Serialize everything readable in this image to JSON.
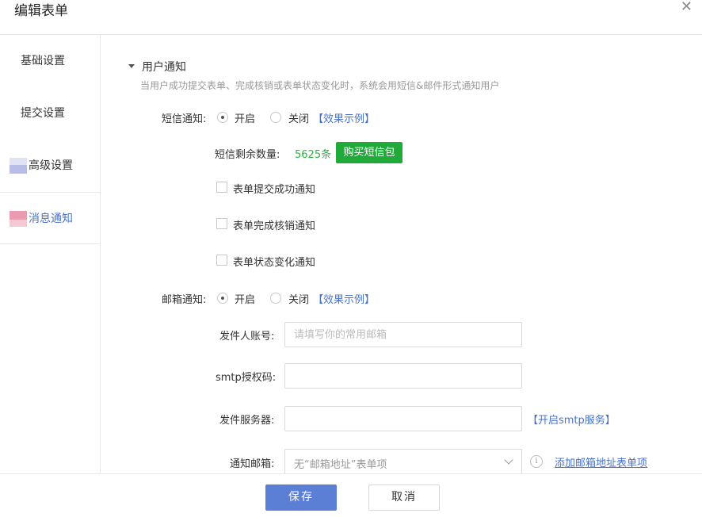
{
  "dialog": {
    "title": "编辑表单",
    "close_glyph": "✕"
  },
  "sidebar": {
    "items": [
      {
        "label": "基础设置"
      },
      {
        "label": "提交设置"
      },
      {
        "label": "高级设置"
      },
      {
        "label": "消息通知"
      }
    ]
  },
  "section": {
    "title": "用户通知",
    "description": "当用户成功提交表单、完成核销或表单状态变化时，系统会用短信&邮件形式通知用户"
  },
  "sms": {
    "label": "短信通知:",
    "option_on": "开启",
    "option_off": "关闭",
    "selected": "开启",
    "example_link": "【效果示例】",
    "remaining_label": "短信剩余数量:",
    "remaining_value": "5625条",
    "buy_button": "购买短信包",
    "checks": [
      {
        "label": "表单提交成功通知"
      },
      {
        "label": "表单完成核销通知"
      },
      {
        "label": "表单状态变化通知"
      }
    ]
  },
  "email": {
    "label": "邮箱通知:",
    "option_on": "开启",
    "option_off": "关闭",
    "selected": "开启",
    "example_link": "【效果示例】",
    "sender_label": "发件人账号:",
    "sender_placeholder": "请填写你的常用邮箱",
    "smtp_label": "smtp授权码:",
    "server_label": "发件服务器:",
    "server_link": "【开启smtp服务】",
    "notify_label": "通知邮箱:",
    "notify_select": "无“邮箱地址”表单项",
    "add_link": "添加邮箱地址表单项"
  },
  "footer": {
    "save": "保存",
    "cancel": "取消"
  }
}
